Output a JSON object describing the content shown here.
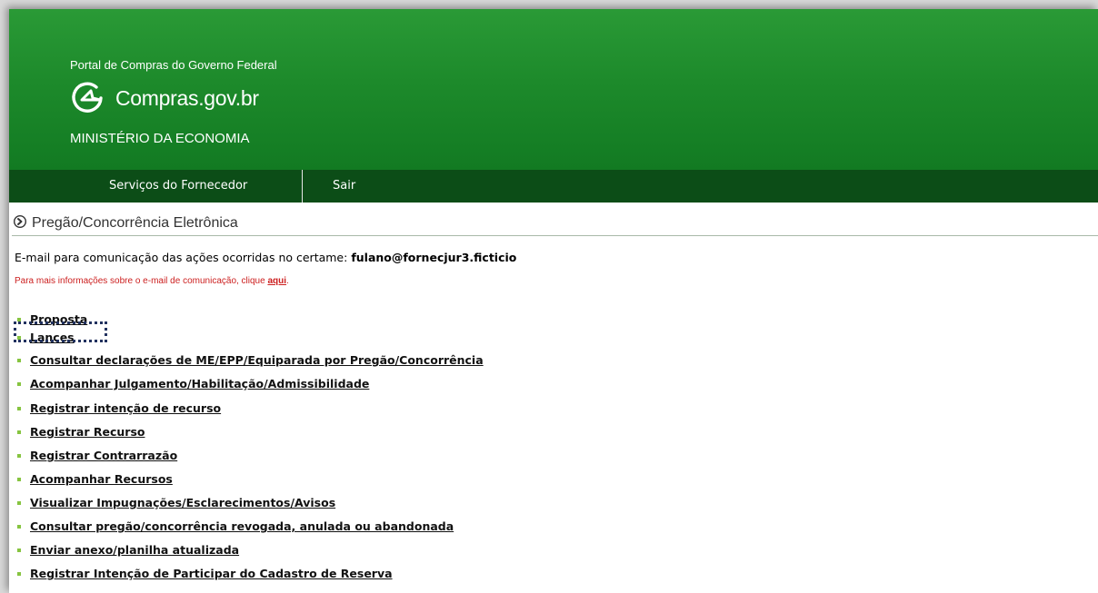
{
  "header": {
    "portal_title": "Portal de Compras do Governo Federal",
    "logo_text": "Compras.gov.br",
    "logo_icon": "compras-logo-icon",
    "ministry": "MINISTÉRIO DA ECONOMIA",
    "colors": {
      "green": "#1d8a2b",
      "nav": "#0c4d17"
    }
  },
  "nav": {
    "items": [
      "Serviços do Fornecedor",
      "Sair"
    ]
  },
  "page": {
    "title": "Pregão/Concorrência Eletrônica",
    "title_icon": "arrow-circle-icon",
    "email_label": "E-mail para comunicação das ações ocorridas no certame:",
    "email_value": "fulano@fornecjur3.ficticio",
    "info_text": "Para mais informações sobre o e-mail de comunicação, clique",
    "info_link": "aqui",
    "info_suffix": ".",
    "info_color": "#cc1f1f"
  },
  "menu": {
    "highlighted_item": "Lances",
    "items": [
      "Proposta",
      "Lances",
      "Consultar declarações de ME/EPP/Equiparada por Pregão/Concorrência",
      "Acompanhar Julgamento/Habilitação/Admissibilidade",
      "Registrar intenção de recurso",
      "Registrar Recurso",
      "Registrar Contrarrazão",
      "Acompanhar Recursos",
      "Visualizar Impugnações/Esclarecimentos/Avisos",
      "Consultar pregão/concorrência revogada, anulada ou abandonada",
      "Enviar anexo/planilha atualizada",
      "Registrar Intenção de Participar do Cadastro de Reserva"
    ]
  }
}
